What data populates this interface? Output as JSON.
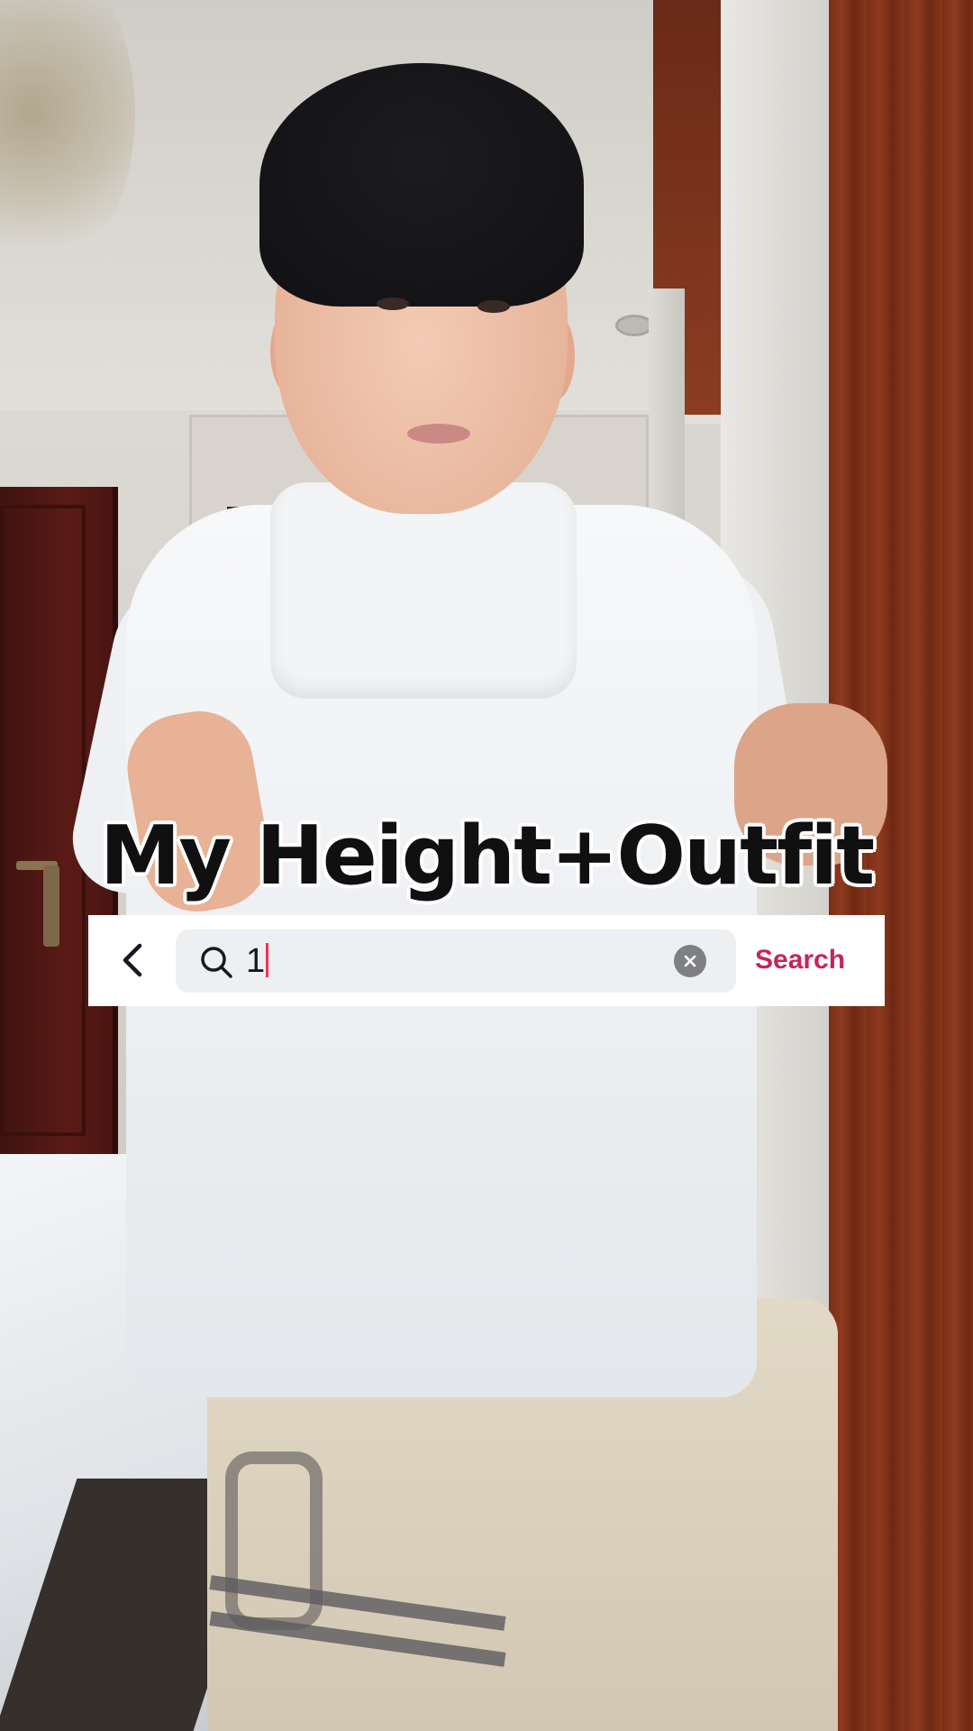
{
  "overlay": {
    "caption": "My Height+Outfit"
  },
  "search": {
    "query": "1",
    "submit_label": "Search",
    "accent_color": "#c7245a",
    "caret_color": "#fe2c55"
  },
  "icons": {
    "back": "chevron-left-icon",
    "search": "magnifier-icon",
    "clear": "close-circle-icon"
  }
}
